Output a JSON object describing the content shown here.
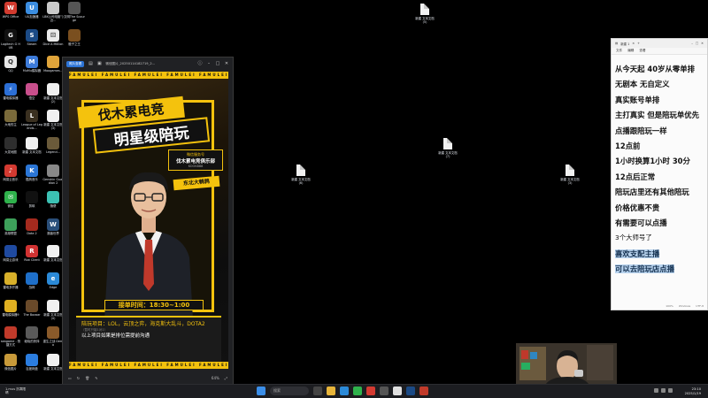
{
  "desktop": {
    "left_icons": [
      {
        "label": "WPS Office",
        "color": "#d23b2f",
        "glyph": "W"
      },
      {
        "label": "UU加速器",
        "color": "#3b8de0",
        "glyph": "U"
      },
      {
        "label": "LBK公司电脑”》近...",
        "color": "#c9c9c9",
        "glyph": ""
      },
      {
        "label": "文明The Scourge",
        "color": "#555",
        "glyph": ""
      },
      {
        "label": "Logitech G HUB",
        "color": "#111",
        "glyph": "G"
      },
      {
        "label": "Steam",
        "color": "#1b4a85",
        "glyph": "S"
      },
      {
        "label": "Dice A Million",
        "color": "#eaeaea",
        "glyph": "⚄"
      },
      {
        "label": "骰子之王",
        "color": "#7a4f1f",
        "glyph": ""
      },
      {
        "label": "QQ",
        "color": "#e8e8e8",
        "glyph": "Q"
      },
      {
        "label": "MuMu模拟器",
        "color": "#3d7bd9",
        "glyph": "M"
      },
      {
        "label": "Moogames...",
        "color": "#e0a43a",
        "glyph": ""
      },
      {
        "label": "",
        "color": "#000",
        "glyph": ""
      },
      {
        "label": "雷电模拟器",
        "color": "#2c6fd6",
        "glyph": "⚡"
      },
      {
        "label": "悟空",
        "color": "#c94f8c",
        "glyph": ""
      },
      {
        "label": "新建 文本文档 (2)",
        "color": "#f0f0f0",
        "glyph": ""
      },
      {
        "label": "",
        "color": "#000",
        "glyph": ""
      },
      {
        "label": "大地的主",
        "color": "#7a6a3a",
        "glyph": ""
      },
      {
        "label": "League of Legends...",
        "color": "#3a3020",
        "glyph": "L"
      },
      {
        "label": "新建 文本文档 (3)",
        "color": "#f0f0f0",
        "glyph": ""
      },
      {
        "label": "",
        "color": "#000",
        "glyph": ""
      },
      {
        "label": "大发地图",
        "color": "#2e2e2e",
        "glyph": ""
      },
      {
        "label": "新建 文本文档",
        "color": "#f0f0f0",
        "glyph": ""
      },
      {
        "label": "Legend...",
        "color": "#6a5a3a",
        "glyph": ""
      },
      {
        "label": "",
        "color": "#000",
        "glyph": ""
      },
      {
        "label": "网易云音乐",
        "color": "#d33a31",
        "glyph": "♪"
      },
      {
        "label": "酷狗音乐",
        "color": "#2b76d6",
        "glyph": "K"
      },
      {
        "label": "Genshin Guardian 2",
        "color": "#888",
        "glyph": ""
      },
      {
        "label": "",
        "color": "#000",
        "glyph": ""
      },
      {
        "label": "微信",
        "color": "#2fb24c",
        "glyph": "✉"
      },
      {
        "label": "剪映",
        "color": "#111",
        "glyph": ""
      },
      {
        "label": "随便",
        "color": "#3cc1b4",
        "glyph": ""
      },
      {
        "label": "",
        "color": "#000",
        "glyph": ""
      },
      {
        "label": "英雄联盟",
        "color": "#3da15a",
        "glyph": ""
      },
      {
        "label": "Dota 2",
        "color": "#a52a1e",
        "glyph": ""
      },
      {
        "label": "魔兽世界",
        "color": "#2a4f7a",
        "glyph": "W"
      },
      {
        "label": "",
        "color": "#000",
        "glyph": ""
      },
      {
        "label": "网易云游戏",
        "color": "#1f4aa0",
        "glyph": ""
      },
      {
        "label": "Riot Client",
        "color": "#d13232",
        "glyph": "R"
      },
      {
        "label": "新建 文本文档",
        "color": "#f0f0f0",
        "glyph": ""
      },
      {
        "label": "",
        "color": "#000",
        "glyph": ""
      },
      {
        "label": "雷电多开器",
        "color": "#d8b02a",
        "glyph": ""
      },
      {
        "label": "战网",
        "color": "#1e6fc9",
        "glyph": ""
      },
      {
        "label": "Edge",
        "color": "#2b8ad8",
        "glyph": "e"
      },
      {
        "label": "",
        "color": "#000",
        "glyph": ""
      },
      {
        "label": "雷电模拟器9",
        "color": "#e0b021",
        "glyph": ""
      },
      {
        "label": "The Bazaar",
        "color": "#6a4a2a",
        "glyph": ""
      },
      {
        "label": "新建 文本文档 (4)",
        "color": "#f0f0f0",
        "glyph": ""
      },
      {
        "label": "",
        "color": "#000",
        "glyph": ""
      },
      {
        "label": "seagame - 快捷方式",
        "color": "#c03a2a",
        "glyph": ""
      },
      {
        "label": "破晓的抉择",
        "color": "#5a5a5a",
        "glyph": ""
      },
      {
        "label": "重生之战 Demo",
        "color": "#8a5a2a",
        "glyph": ""
      },
      {
        "label": "",
        "color": "#000",
        "glyph": ""
      },
      {
        "label": "微信图片",
        "color": "#c89a3a",
        "glyph": ""
      },
      {
        "label": "百度网盘",
        "color": "#2b7de0",
        "glyph": ""
      },
      {
        "label": "新建 文本文档",
        "color": "#f0f0f0",
        "glyph": ""
      },
      {
        "label": "Dark Deception",
        "color": "#8a1a1a",
        "glyph": ""
      }
    ],
    "loose_files": [
      {
        "label": "新建 文本文档 (5)"
      },
      {
        "label": "新建 文本文档 (7)"
      },
      {
        "label": "新建 文本文档 (6)"
      },
      {
        "label": "新建 文本文档 (3)"
      }
    ]
  },
  "viewer": {
    "tab_label": "照片查看",
    "file_title": "微信图片_20250114182719_2...",
    "stripe_text": "FAMULEI  FAMULEI  FAMULEI  FAMULEI  FAMULEI  FAMULEI",
    "poster": {
      "title_line1": "伐木累电竞",
      "title_line2": "明星级陪玩",
      "wechat_caption": "微信服务号",
      "wechat_name": "伐木累电竞俱乐部",
      "wechat_id": "KOOK888",
      "region": "东北大鹌鹑",
      "hours": "接单时间：18:30~1:00",
      "games_label": "陪玩项目：LOL，云顶之弈，海克斯大乱斗，DOTA2",
      "games_note": "（暂时只接1对1）",
      "footer": "以上项目如果是排位需提前沟通"
    },
    "zoom": "64%"
  },
  "notepad": {
    "tab_title": "新建 1",
    "menu": [
      "文件",
      "编辑",
      "查看"
    ],
    "lines": [
      {
        "text": "从今天起 40岁从零单排",
        "style": "bold"
      },
      {
        "text": "无剧本 无自定义",
        "style": "bold"
      },
      {
        "text": "真实账号单排",
        "style": "bold"
      },
      {
        "text": "主打真实 但是陪玩单优先",
        "style": "bold"
      },
      {
        "text": "点播跟陪玩一样",
        "style": "bold"
      },
      {
        "text": "12点前",
        "style": "bold"
      },
      {
        "text": "1小时换算1小时 30分",
        "style": "bold"
      },
      {
        "text": "12点后正常",
        "style": "bold"
      },
      {
        "text": "陪玩店里还有其他陪玩",
        "style": "bold"
      },
      {
        "text": "价格优惠不贵",
        "style": "bold"
      },
      {
        "text": "有需要可以点播",
        "style": "bold"
      },
      {
        "text": "3个大师号了",
        "style": "small"
      },
      {
        "text": "喜欢支配主播",
        "style": "highlight"
      },
      {
        "text": "可以去陪玩店点播",
        "style": "highlight"
      }
    ],
    "status": [
      "100%",
      "Windows",
      "UTF-8"
    ]
  },
  "taskbar": {
    "weather": "1.mus 抗寒限",
    "weather_sub": "晴",
    "search_placeholder": "搜索",
    "time": "23:10",
    "date": "2025/1/19"
  }
}
